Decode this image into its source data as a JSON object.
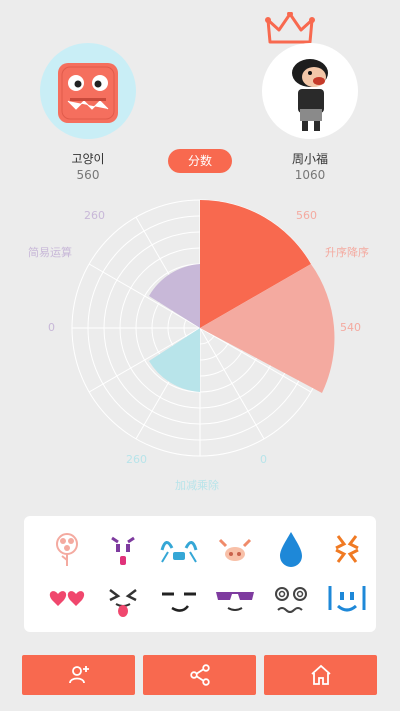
{
  "players": {
    "left": {
      "name": "고양이",
      "score": "560"
    },
    "right": {
      "name": "周小福",
      "score": "1060"
    }
  },
  "score_button": "分数",
  "chart_data": {
    "type": "polar-area",
    "categories": [
      "升序降序",
      "加减乘除",
      "简易运算"
    ],
    "series": [
      {
        "values": [
          560,
          0,
          260
        ],
        "color": "#f8694f"
      },
      {
        "values": [
          540,
          260,
          0
        ],
        "color": "#f4aaa0"
      }
    ],
    "left_scores": {
      "升序降序": 560,
      "加减乘除": 0,
      "简易运算": 260
    },
    "right_scores": {
      "升序降序": 540,
      "加减乘除": 260,
      "简易运算": 0
    },
    "labels": {
      "top_right_value": "560",
      "right_category": "升序降序",
      "right_value": "540",
      "bottom_right_value": "0",
      "bottom_category": "加减乘除",
      "bottom_left_value": "260",
      "left_value": "0",
      "left_category": "简易运算",
      "top_left_value": "260"
    },
    "colors": {
      "top_right": "#f8694f",
      "right": "#f4aaa0",
      "bottom": "#b8e4ea",
      "left": "#c8b8d8"
    }
  },
  "emoji": [
    "flower-icon",
    "devil-icon",
    "crying-icon",
    "pig-face-icon",
    "water-drop-icon",
    "anger-icon",
    "heart-eyes-icon",
    "tongue-out-icon",
    "smirk-icon",
    "sunglasses-icon",
    "dizzy-icon",
    "smile-icon"
  ],
  "buttons": [
    "add-friend-icon",
    "share-icon",
    "home-icon"
  ]
}
